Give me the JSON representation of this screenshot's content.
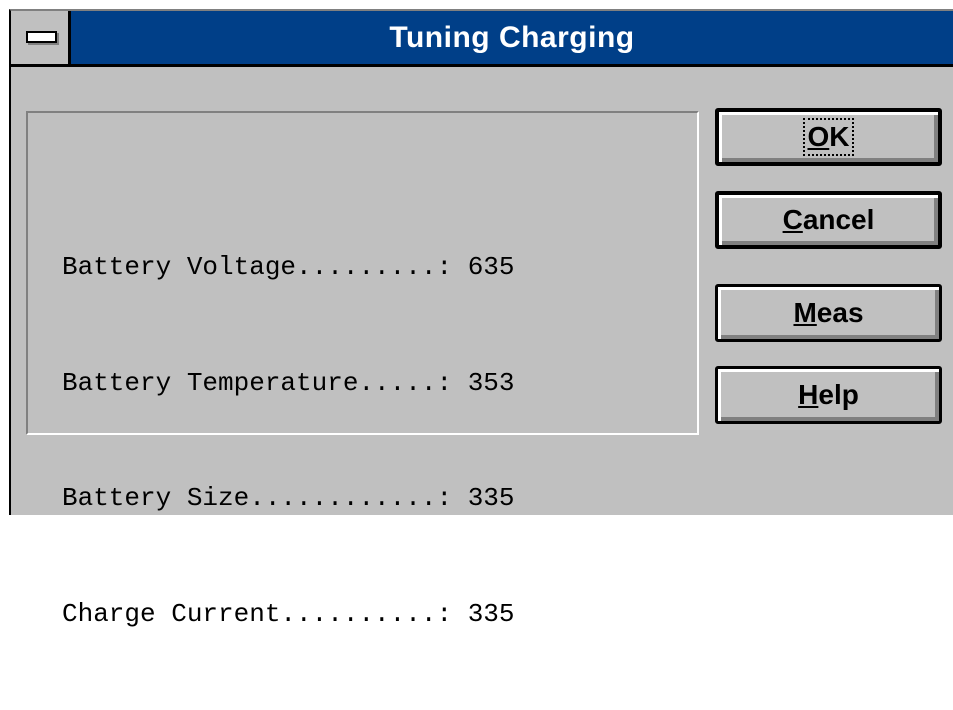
{
  "window": {
    "title": "Tuning Charging"
  },
  "readings": [
    {
      "label": "Battery Voltage.........:",
      "value": "635"
    },
    {
      "label": "Battery Temperature.....:",
      "value": "353"
    },
    {
      "label": "Battery Size............:",
      "value": "335"
    },
    {
      "label": "Charge Current..........:",
      "value": "335"
    }
  ],
  "buttons": {
    "ok": {
      "mnemonic": "O",
      "rest": "K"
    },
    "cancel": {
      "mnemonic": "C",
      "rest": "ancel"
    },
    "meas": {
      "mnemonic": "M",
      "rest": "eas"
    },
    "help": {
      "mnemonic": "H",
      "rest": "elp"
    }
  }
}
